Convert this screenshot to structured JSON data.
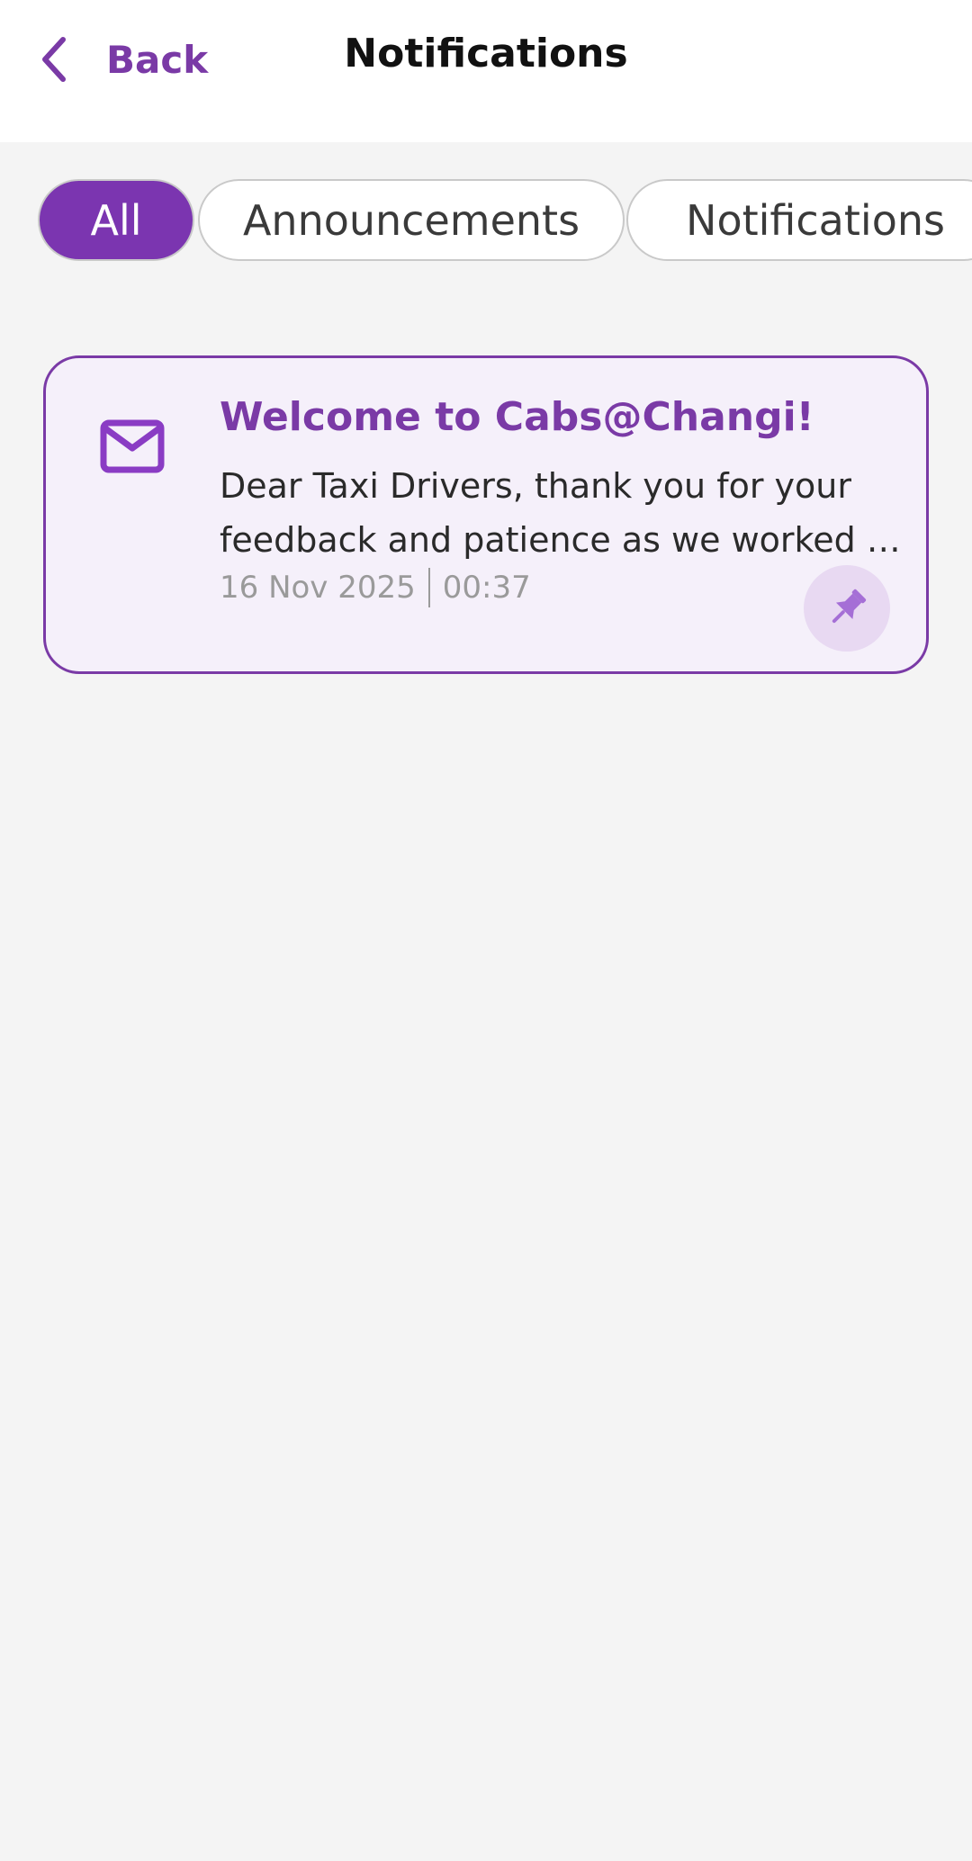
{
  "header": {
    "back_label": "Back",
    "title": "Notifications"
  },
  "tabs": [
    {
      "label": "All",
      "active": true
    },
    {
      "label": "Announcements",
      "active": false
    },
    {
      "label": "Notifications",
      "active": false
    }
  ],
  "notifications": [
    {
      "icon": "mail-icon",
      "title": "Welcome to Cabs@Changi!",
      "body_line_1": "Dear Taxi Drivers, thank you for your",
      "body_line_2": "feedback and patience as we worked …",
      "date": "16 Nov 2025",
      "time": "00:37",
      "pin_icon": "pin-icon"
    }
  ],
  "colors": {
    "accent": "#7a3aa6",
    "tab_active_bg": "#7b35b0",
    "card_bg": "#f5f0fa",
    "pin_bg": "#e8d9f2",
    "page_bg": "#f4f4f4"
  }
}
